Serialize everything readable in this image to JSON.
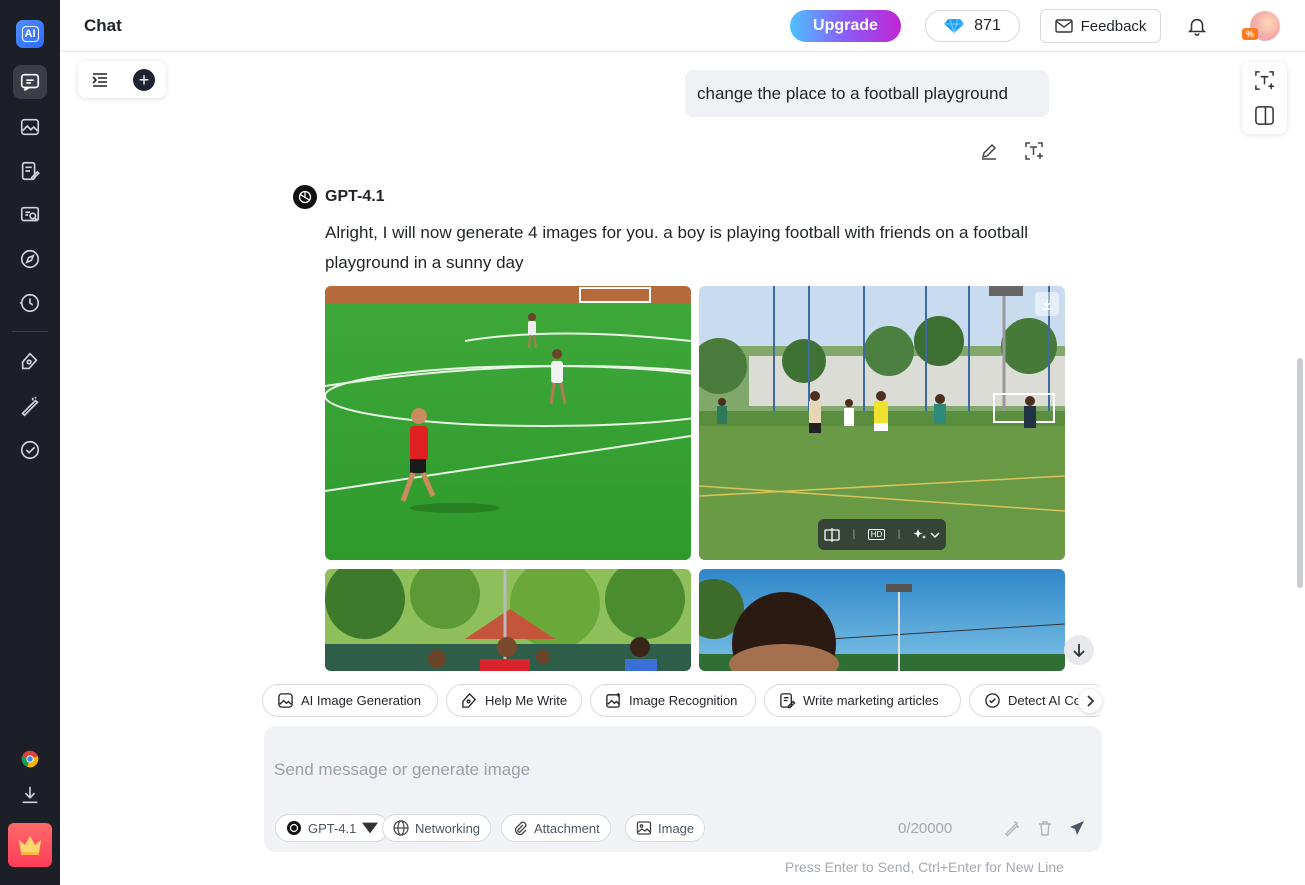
{
  "header": {
    "title": "Chat",
    "upgrade_label": "Upgrade",
    "gem_count": "871",
    "feedback_label": "Feedback",
    "avatar_badge": "%"
  },
  "sidebar": {
    "logo": "AI",
    "items": [
      {
        "icon": "chat-icon",
        "active": true
      },
      {
        "icon": "image-gallery-icon"
      },
      {
        "icon": "write-doc-icon"
      },
      {
        "icon": "search-doc-icon"
      },
      {
        "icon": "compass-icon"
      },
      {
        "icon": "history-icon"
      },
      {
        "icon": "pen-tool-icon"
      },
      {
        "icon": "magic-wand-icon"
      },
      {
        "icon": "check-circle-icon"
      },
      {
        "icon": "chrome-icon"
      },
      {
        "icon": "download-icon"
      },
      {
        "icon": "crown-icon"
      }
    ]
  },
  "conversation": {
    "user_message": "change the place to a football playground",
    "bot_name": "GPT-4.1",
    "bot_message": "Alright, I will now generate 4 images for you. a boy is playing football with friends on a football playground in a sunny day",
    "image_toolbar": {
      "hd_label": "HD"
    }
  },
  "quick_actions": [
    {
      "label": "AI Image Generation",
      "icon": "image-icon"
    },
    {
      "label": "Help Me Write",
      "icon": "pen-icon"
    },
    {
      "label": "Image Recognition",
      "icon": "image-scan-icon"
    },
    {
      "label": "Write marketing articles",
      "icon": "article-icon"
    },
    {
      "label": "Detect AI Co",
      "icon": "check-circle-icon"
    }
  ],
  "composer": {
    "placeholder": "Send message or generate image",
    "model_label": "GPT-4.1",
    "networking_label": "Networking",
    "attachment_label": "Attachment",
    "image_label": "Image",
    "counter": "0/20000",
    "hint": "Press Enter to Send, Ctrl+Enter for New Line"
  },
  "colors": {
    "sidebar_bg": "#1c1f26",
    "accent_blue": "#2d6bff",
    "input_bg": "#f0f2f6"
  }
}
